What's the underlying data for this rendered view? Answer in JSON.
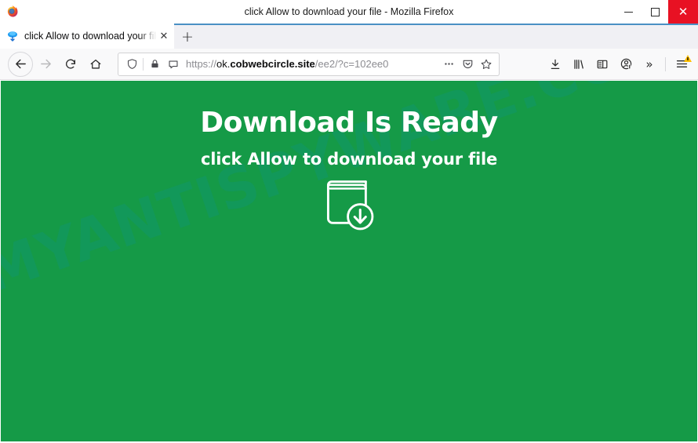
{
  "window": {
    "title": "click Allow to download your file - Mozilla Firefox",
    "minimize_label": "Minimize",
    "maximize_label": "Maximize",
    "close_label": "Close"
  },
  "tabbar": {
    "tab_title": "click Allow to download your file",
    "tab_close_label": "✕",
    "new_tab_label": "+",
    "favicon_name": "blue-cloud-favicon"
  },
  "toolbar": {
    "back_label": "Back",
    "forward_label": "Forward",
    "reload_label": "Reload",
    "home_label": "Home",
    "downloads_label": "Downloads",
    "library_label": "Library",
    "sidebar_label": "Sidebar",
    "account_label": "Account",
    "overflow_label": "»",
    "menu_label": "Open menu"
  },
  "urlbar": {
    "scheme": "https://",
    "subdomain": "ok.",
    "host": "cobwebcircle.site",
    "path": "/ee2/?c=102ee0",
    "full_url": "https://ok.cobwebcircle.site/ee2/?c=102ee0",
    "shield_icon": "tracking-protection-shield",
    "lock_icon": "padlock-secure",
    "permissions_icon": "site-permissions-bubble",
    "page_actions_label": "•••",
    "pocket_label": "Save to Pocket",
    "bookmark_label": "Bookmark this page"
  },
  "page": {
    "title": "Download Is Ready",
    "subtitle": "click Allow to download your file",
    "icon_name": "book-download-icon",
    "watermark": "MYANTISPYWARE.COM",
    "background_color": "#159a47",
    "text_color": "#ffffff",
    "watermark_color": "#109682"
  }
}
